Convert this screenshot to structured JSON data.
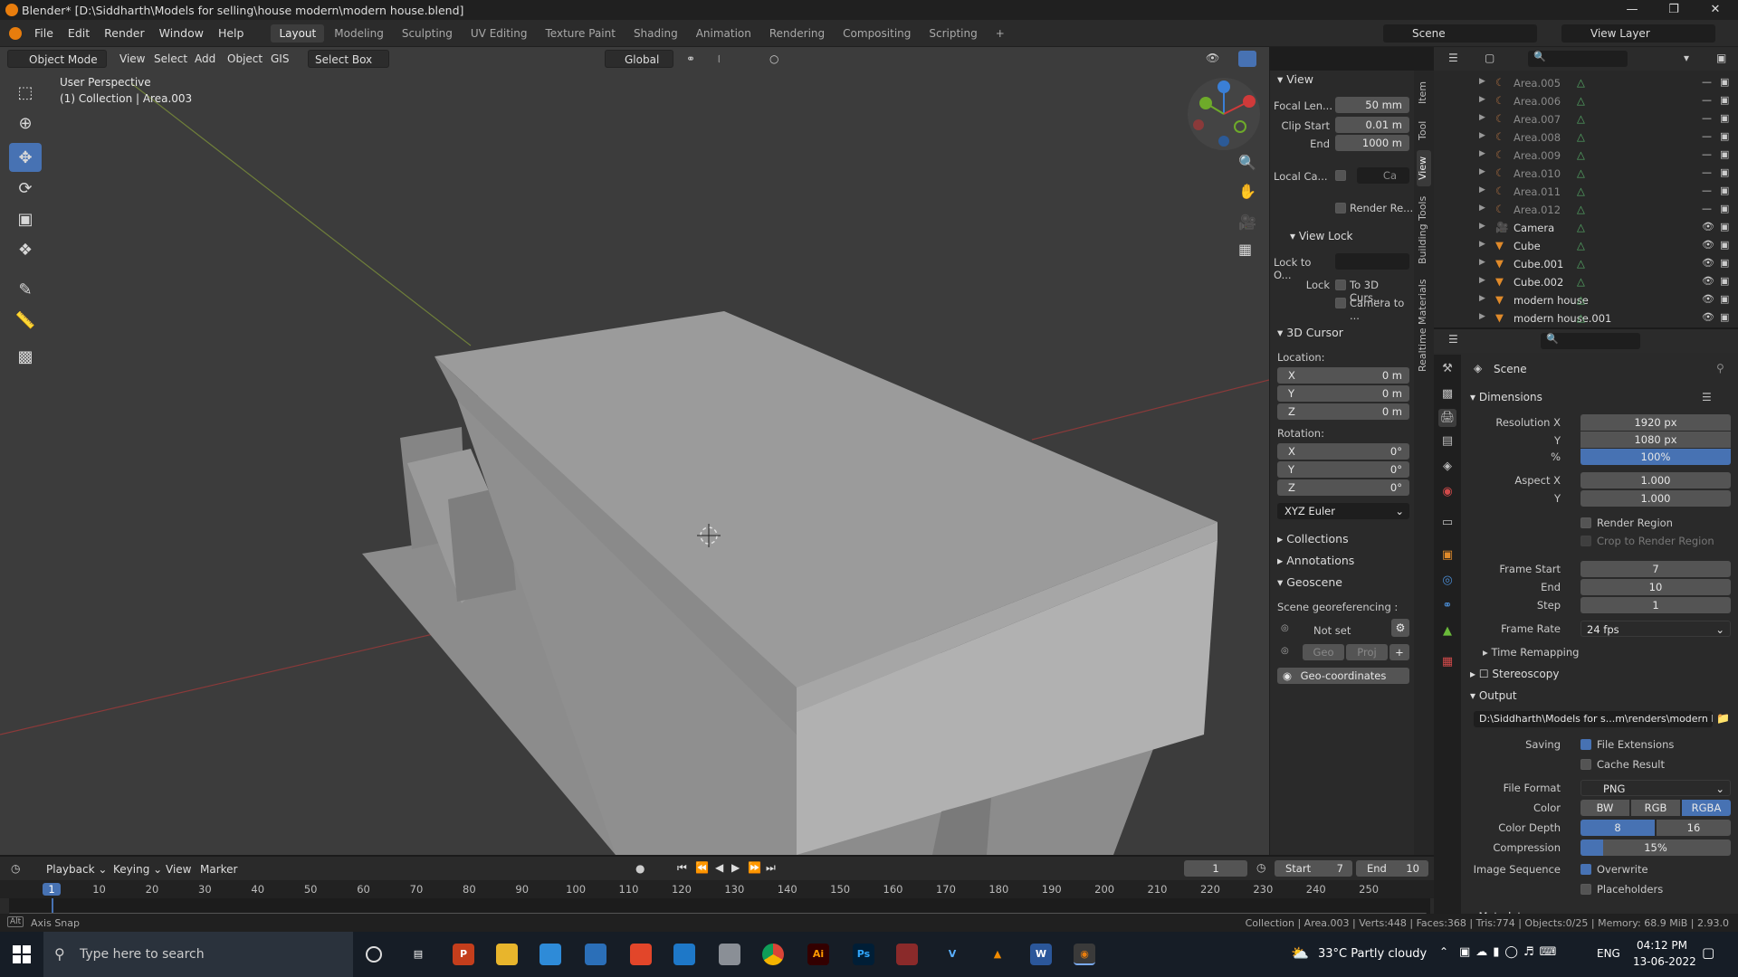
{
  "window": {
    "title": "Blender* [D:\\Siddharth\\Models for selling\\house modern\\modern house.blend]"
  },
  "menu": {
    "items": [
      "File",
      "Edit",
      "Render",
      "Window",
      "Help"
    ]
  },
  "workspaces": [
    "Layout",
    "Modeling",
    "Sculpting",
    "UV Editing",
    "Texture Paint",
    "Shading",
    "Animation",
    "Rendering",
    "Compositing",
    "Scripting"
  ],
  "topright": {
    "scene": "Scene",
    "view_layer": "View Layer"
  },
  "viewport_header": {
    "mode": "Object Mode",
    "menus": [
      "View",
      "Select",
      "Add",
      "Object",
      "GIS"
    ],
    "select_box": "Select Box",
    "orientation": "Global"
  },
  "viewport": {
    "perspective": "User Perspective",
    "collection": "(1) Collection | Area.003"
  },
  "npanel": {
    "tabs": [
      "Item",
      "Tool",
      "View",
      "Building Tools",
      "Realtime Materials"
    ],
    "view_header": "View",
    "focal_label": "Focal Len...",
    "focal_value": "50 mm",
    "clip_start_label": "Clip Start",
    "clip_start_value": "0.01 m",
    "end_label": "End",
    "end_value": "1000 m",
    "local_camera_label": "Local Ca...",
    "local_camera_field": "Ca",
    "render_region_label": "Render Re...",
    "view_lock_header": "View Lock",
    "lock_to_object_label": "Lock to O...",
    "lock_label": "Lock",
    "to_3d_cursor": "To 3D Curs...",
    "camera_to": "Camera to ...",
    "cursor_header": "3D Cursor",
    "location_label": "Location:",
    "loc": [
      {
        "axis": "X",
        "val": "0 m"
      },
      {
        "axis": "Y",
        "val": "0 m"
      },
      {
        "axis": "Z",
        "val": "0 m"
      }
    ],
    "rotation_label": "Rotation:",
    "rot": [
      {
        "axis": "X",
        "val": "0°"
      },
      {
        "axis": "Y",
        "val": "0°"
      },
      {
        "axis": "Z",
        "val": "0°"
      }
    ],
    "rotation_mode": "XYZ Euler",
    "collections": "Collections",
    "annotations": "Annotations",
    "geoscene": "Geoscene",
    "georef_label": "Scene georeferencing :",
    "not_set": "Not set",
    "geo": "Geo",
    "proj": "Proj",
    "geo_coords": "Geo-coordinates"
  },
  "outliner": {
    "rows": [
      {
        "name": "Area.005"
      },
      {
        "name": "Area.006"
      },
      {
        "name": "Area.007"
      },
      {
        "name": "Area.008"
      },
      {
        "name": "Area.009"
      },
      {
        "name": "Area.010"
      },
      {
        "name": "Area.011"
      },
      {
        "name": "Area.012"
      },
      {
        "name": "Camera"
      },
      {
        "name": "Cube"
      },
      {
        "name": "Cube.001"
      },
      {
        "name": "Cube.002"
      },
      {
        "name": "modern house"
      },
      {
        "name": "modern house.001"
      }
    ]
  },
  "props": {
    "scene": "Scene",
    "dimensions": "Dimensions",
    "res_x_label": "Resolution X",
    "res_x": "1920 px",
    "res_y_label": "Y",
    "res_y": "1080 px",
    "pct_label": "%",
    "pct": "100%",
    "aspect_x_label": "Aspect X",
    "aspect_x": "1.000",
    "aspect_y_label": "Y",
    "aspect_y": "1.000",
    "render_region": "Render Region",
    "crop_region": "Crop to Render Region",
    "frame_start_label": "Frame Start",
    "frame_start": "7",
    "frame_end_label": "End",
    "frame_end": "10",
    "step_label": "Step",
    "step": "1",
    "frame_rate_label": "Frame Rate",
    "frame_rate": "24 fps",
    "time_remap": "Time Remapping",
    "stereoscopy": "Stereoscopy",
    "output": "Output",
    "output_path": "D:\\Siddharth\\Models for s...m\\renders\\modern house",
    "saving_label": "Saving",
    "file_ext": "File Extensions",
    "cache_result": "Cache Result",
    "file_format_label": "File Format",
    "file_format": "PNG",
    "color_label": "Color",
    "color_opts": [
      "BW",
      "RGB",
      "RGBA"
    ],
    "depth_label": "Color Depth",
    "depth_opts": [
      "8",
      "16"
    ],
    "compression_label": "Compression",
    "compression": "15%",
    "compression_value": 0.15,
    "image_seq_label": "Image Sequence",
    "overwrite": "Overwrite",
    "placeholders": "Placeholders",
    "metadata": "Metadata"
  },
  "timeline": {
    "menus": [
      "Playback",
      "Keying",
      "View",
      "Marker"
    ],
    "current_frame": "1",
    "start_label": "Start",
    "start": "7",
    "end_label": "End",
    "end": "10",
    "ticks": [
      "1",
      "10",
      "20",
      "30",
      "40",
      "50",
      "60",
      "70",
      "80",
      "90",
      "100",
      "110",
      "120",
      "130",
      "140",
      "150",
      "160",
      "170",
      "180",
      "190",
      "200",
      "210",
      "220",
      "230",
      "240",
      "250"
    ]
  },
  "status": {
    "left": "Axis Snap",
    "right": "Collection | Area.003 | Verts:448 | Faces:368 | Tris:774 | Objects:0/25 | Memory: 68.9 MiB | 2.93.0"
  },
  "taskbar": {
    "search_placeholder": "Type here to search",
    "weather": "33°C  Partly cloudy",
    "lang": "ENG",
    "time": "04:12 PM",
    "date": "13-06-2022"
  },
  "colors": {
    "accent": "#4772b3",
    "viewport": "#3c3c3c",
    "panel": "#2a2a2a"
  }
}
